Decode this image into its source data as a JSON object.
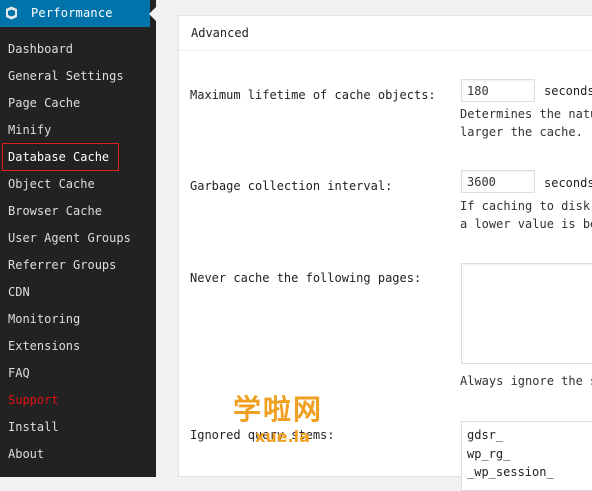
{
  "sidebar": {
    "title": "Performance",
    "logo_icon": "w3-total-cache-icon",
    "items": [
      {
        "label": "Dashboard"
      },
      {
        "label": "General Settings"
      },
      {
        "label": "Page Cache"
      },
      {
        "label": "Minify"
      },
      {
        "label": "Database Cache",
        "active": true
      },
      {
        "label": "Object Cache"
      },
      {
        "label": "Browser Cache"
      },
      {
        "label": "User Agent Groups"
      },
      {
        "label": "Referrer Groups"
      },
      {
        "label": "CDN"
      },
      {
        "label": "Monitoring"
      },
      {
        "label": "Extensions"
      },
      {
        "label": "FAQ"
      },
      {
        "label": "Support",
        "color": "#e01010"
      },
      {
        "label": "Install"
      },
      {
        "label": "About"
      }
    ]
  },
  "panel": {
    "title": "Advanced",
    "fields": {
      "lifetime": {
        "label": "Maximum lifetime of cache objects:",
        "value": "180",
        "unit": "seconds",
        "desc_line1": "Determines the natu",
        "desc_line2": "larger the cache."
      },
      "gc": {
        "label": "Garbage collection interval:",
        "value": "3600",
        "unit": "seconds",
        "desc_line1": "If caching to disk,",
        "desc_line2": "a lower value is be"
      },
      "never_cache": {
        "label": "Never cache the following pages:",
        "value": "",
        "desc": "Always ignore the s"
      },
      "ignored_stems": {
        "label": "Ignored query stems:",
        "lines": [
          "gdsr_",
          "wp_rg_",
          "_wp_session_"
        ]
      }
    }
  },
  "watermark": {
    "main": "学啦网",
    "sub": "xue.la",
    "color": "#f0a020"
  },
  "colors": {
    "sidebar_bg": "#222222",
    "header_bg": "#0073aa",
    "active_outline": "#dd1f1f"
  }
}
